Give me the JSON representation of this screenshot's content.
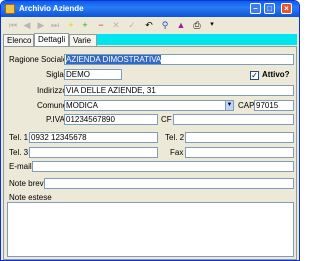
{
  "window": {
    "title": "Archivio Aziende"
  },
  "toolbar": {
    "icons": [
      "first-icon",
      "prev-icon",
      "next-icon",
      "last-icon",
      "add-icon",
      "new-icon",
      "delete-icon",
      "cancel-icon",
      "refresh-icon",
      "search-icon",
      "filter-icon",
      "print-icon",
      "dropdown-icon"
    ]
  },
  "tabs": {
    "elenco": "Elenco",
    "dettagli": "Dettagli",
    "varie": "Varie"
  },
  "form": {
    "ragione_sociale_label": "Ragione Sociale",
    "ragione_sociale_value": "AZIENDA DIMOSTRATIVA",
    "sigla_label": "Sigla",
    "sigla_value": "DEMO",
    "attivo_label": "Attivo?",
    "attivo_checked": "✓",
    "indirizzo_label": "Indirizzo",
    "indirizzo_value": "VIA DELLE AZIENDE, 31",
    "comune_label": "Comune",
    "comune_value": "MODICA",
    "cap_label": "CAP",
    "cap_value": "97015",
    "piva_label": "P.IVA",
    "piva_value": "01234567890",
    "cf_label": "CF",
    "cf_value": "",
    "tel1_label": "Tel. 1",
    "tel1_value": "0932 12345678",
    "tel2_label": "Tel. 2",
    "tel2_value": "",
    "tel3_label": "Tel. 3",
    "tel3_value": "",
    "fax_label": "Fax",
    "fax_value": "",
    "email_label": "E-mail",
    "email_value": "",
    "note_brevi_label": "Note brevi",
    "note_brevi_value": "",
    "note_estese_label": "Note estese"
  }
}
